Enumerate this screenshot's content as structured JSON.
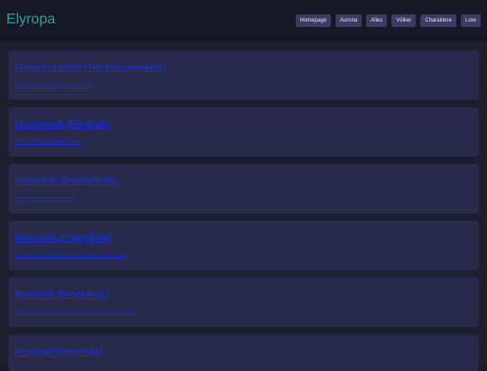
{
  "app": {
    "title": "Elyropa"
  },
  "nav": {
    "items": [
      {
        "label": "Homepage"
      },
      {
        "label": "Aurona"
      },
      {
        "label": "Alles"
      },
      {
        "label": "Völker"
      },
      {
        "label": "Charaktere"
      },
      {
        "label": "Lore"
      }
    ]
  },
  "cards": [
    {
      "title": "Friedenssucher (The Peacemakers)",
      "desc": "The peaceful Folk living around the Pillar"
    },
    {
      "title": "Fichtenvolk (PineFolk)",
      "desc": "The Folk that lives among trees/fir"
    },
    {
      "title": "FederVolk (FeatherFolk)",
      "desc": "The Folk that flies in the skies"
    },
    {
      "title": "MohnVolk (PoppyFolk)",
      "desc": "The peaceful communication with the spirits of the world"
    },
    {
      "title": "BachVolk (BrookFolk)",
      "desc": "The fisherfolk who living near and that trade at the waterfront"
    },
    {
      "title": "FrostVolk (frostFolk)",
      "desc": ""
    }
  ],
  "colors": {
    "brand": "#27a3a3",
    "nav_button_bg": "#3a3d62",
    "card_bg": "#272a4b",
    "link": "#1a2bd0",
    "page_bg": "#1d1e2e"
  }
}
